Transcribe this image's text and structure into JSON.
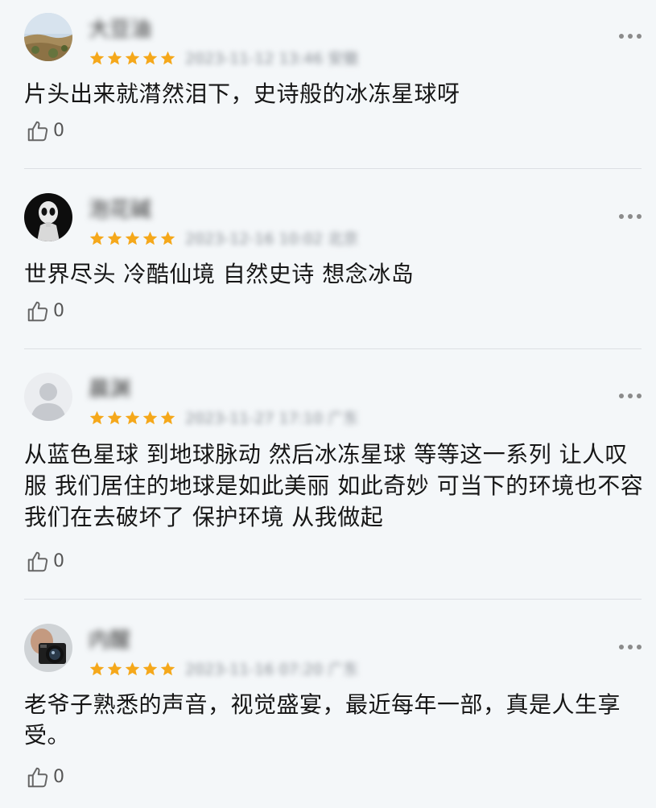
{
  "reviews": [
    {
      "username": "大豆油",
      "avatar": "landscape-avatar",
      "rating": 5,
      "meta": "2023-11-12 13:46 安徽",
      "content": "片头出来就潸然泪下，史诗般的冰冻星球呀",
      "likes": "0"
    },
    {
      "username": "泡花碱",
      "avatar": "alien-avatar",
      "rating": 5,
      "meta": "2023-12-16 10:02 北京",
      "content": "世界尽头 冷酷仙境 自然史诗 想念冰岛",
      "likes": "0"
    },
    {
      "username": "晨渊",
      "avatar": "default-avatar",
      "rating": 5,
      "meta": "2023-11-27 17:10 广东",
      "content": "从蓝色星球 到地球脉动 然后冰冻星球 等等这一系列 让人叹服 我们居住的地球是如此美丽 如此奇妙 可当下的环境也不容我们在去破坏了 保护环境 从我做起",
      "likes": "0"
    },
    {
      "username": "内醒",
      "avatar": "camera-avatar",
      "rating": 5,
      "meta": "2023-11-16 07:20 广东",
      "content": "老爷子熟悉的声音，视觉盛宴，最近每年一部，真是人生享受。",
      "likes": "0"
    }
  ],
  "colors": {
    "background": "#f4f7f9",
    "star": "#f5a81b",
    "divider": "#dcdfe3"
  },
  "icons": {
    "like": "thumbs-up-icon",
    "more": "more-dots-icon",
    "star": "star-icon"
  }
}
